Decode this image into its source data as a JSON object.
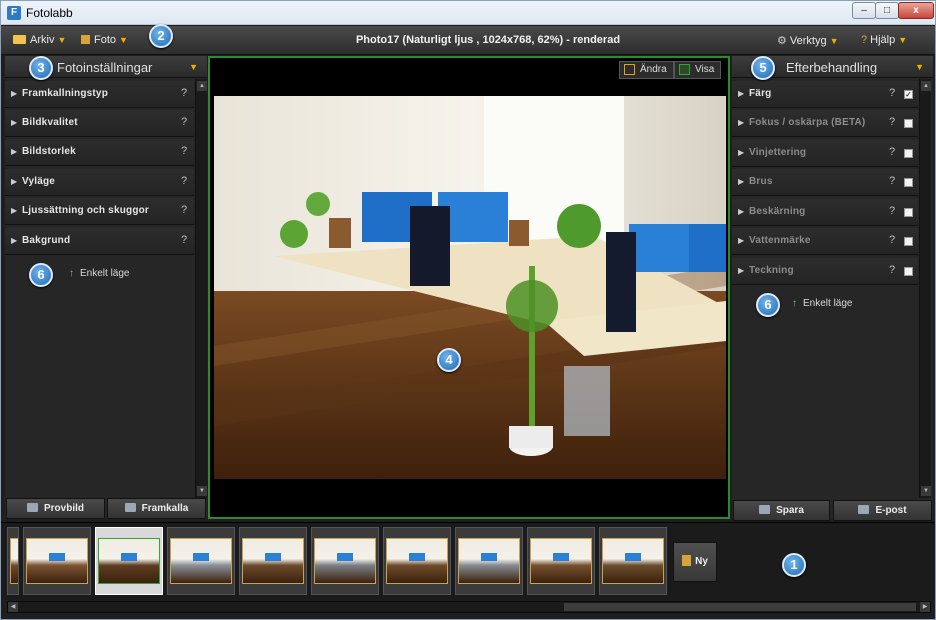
{
  "window": {
    "title": "Fotolabb",
    "controls": {
      "minimize": "–",
      "maximize": "□",
      "close": "x"
    }
  },
  "menubar": {
    "left_menus": [
      {
        "label": "Arkiv"
      },
      {
        "label": "Foto"
      }
    ],
    "document_title": "Photo17 (Naturligt ljus , 1024x768, 62%) - renderad",
    "right_menus": [
      {
        "label": "Verktyg"
      },
      {
        "label": "Hjälp"
      }
    ]
  },
  "badges": [
    "1",
    "2",
    "3",
    "4",
    "5",
    "6",
    "6"
  ],
  "left_panel": {
    "title": "Fotoinställningar",
    "sections": [
      {
        "label": "Framkallningstyp",
        "help": "?"
      },
      {
        "label": "Bildkvalitet",
        "help": "?"
      },
      {
        "label": "Bildstorlek",
        "help": "?"
      },
      {
        "label": "Vyläge",
        "help": "?"
      },
      {
        "label": "Ljussättning och skuggor",
        "help": "?"
      },
      {
        "label": "Bakgrund",
        "help": "?"
      }
    ],
    "simple_mode": "Enkelt läge",
    "buttons": {
      "preview": "Provbild",
      "render": "Framkalla"
    }
  },
  "viewer": {
    "toggles": [
      {
        "label": "Ändra",
        "color": "#e0a020"
      },
      {
        "label": "Visa",
        "color": "#3aa03a"
      }
    ]
  },
  "right_panel": {
    "title": "Efterbehandling",
    "sections": [
      {
        "label": "Färg",
        "help": "?",
        "checked": true,
        "enabled": true
      },
      {
        "label": "Fokus / oskärpa (BETA)",
        "help": "?",
        "checked": false,
        "enabled": false
      },
      {
        "label": "Vinjettering",
        "help": "?",
        "checked": false,
        "enabled": false
      },
      {
        "label": "Brus",
        "help": "?",
        "checked": false,
        "enabled": false
      },
      {
        "label": "Beskärning",
        "help": "?",
        "checked": false,
        "enabled": false
      },
      {
        "label": "Vattenmärke",
        "help": "?",
        "checked": false,
        "enabled": false
      },
      {
        "label": "Teckning",
        "help": "?",
        "checked": false,
        "enabled": false
      }
    ],
    "simple_mode": "Enkelt läge",
    "buttons": {
      "save": "Spara",
      "email": "E-post"
    }
  },
  "filmstrip": {
    "thumbnail_count": 10,
    "selected_index": 2,
    "new_button": "Ny"
  },
  "colors": {
    "accent": "#f0b000",
    "viewer_border": "#2e8a2e",
    "badge": "#1f6cb6"
  }
}
